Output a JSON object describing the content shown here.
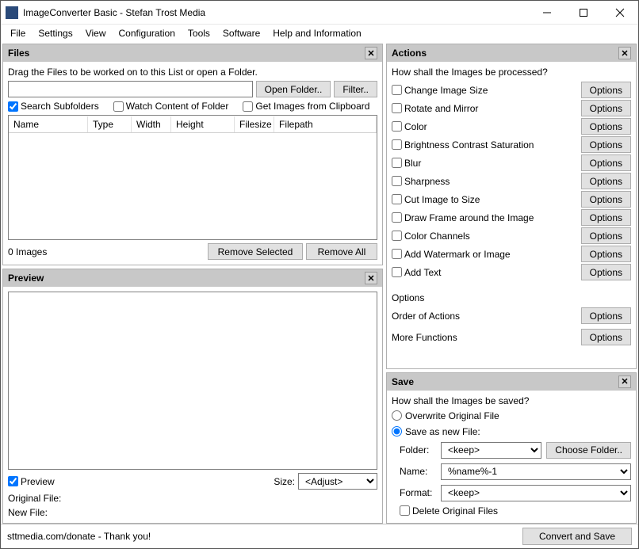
{
  "window": {
    "title": "ImageConverter Basic - Stefan Trost Media"
  },
  "menu": [
    "File",
    "Settings",
    "View",
    "Configuration",
    "Tools",
    "Software",
    "Help and Information"
  ],
  "files_panel": {
    "title": "Files",
    "hint": "Drag the Files to be worked on to this List or open a Folder.",
    "path_value": "",
    "open_folder": "Open Folder..",
    "filter": "Filter..",
    "search_subfolders": "Search Subfolders",
    "watch_folder": "Watch Content of Folder",
    "from_clipboard": "Get Images from Clipboard",
    "columns": [
      "Name",
      "Type",
      "Width",
      "Height",
      "Filesize",
      "Filepath"
    ],
    "count": "0 Images",
    "remove_selected": "Remove Selected",
    "remove_all": "Remove All"
  },
  "preview_panel": {
    "title": "Preview",
    "preview_chk": "Preview",
    "size_label": "Size:",
    "size_value": "<Adjust>",
    "orig_file": "Original File:",
    "new_file": "New File:"
  },
  "actions_panel": {
    "title": "Actions",
    "question": "How shall the Images be processed?",
    "options_label": "Options",
    "items": [
      "Change Image Size",
      "Rotate and Mirror",
      "Color",
      "Brightness Contrast Saturation",
      "Blur",
      "Sharpness",
      "Cut Image to Size",
      "Draw Frame around the Image",
      "Color Channels",
      "Add Watermark or Image",
      "Add Text"
    ],
    "sect_options": "Options",
    "order": "Order of Actions",
    "more": "More Functions"
  },
  "save_panel": {
    "title": "Save",
    "question": "How shall the Images be saved?",
    "overwrite": "Overwrite Original File",
    "save_as_new": "Save as new File:",
    "folder_lbl": "Folder:",
    "folder_val": "<keep>",
    "choose_folder": "Choose Folder..",
    "name_lbl": "Name:",
    "name_val": "%name%-1",
    "format_lbl": "Format:",
    "format_val": "<keep>",
    "delete_orig": "Delete Original Files"
  },
  "footer": {
    "status": "sttmedia.com/donate - Thank you!",
    "convert": "Convert and Save"
  }
}
